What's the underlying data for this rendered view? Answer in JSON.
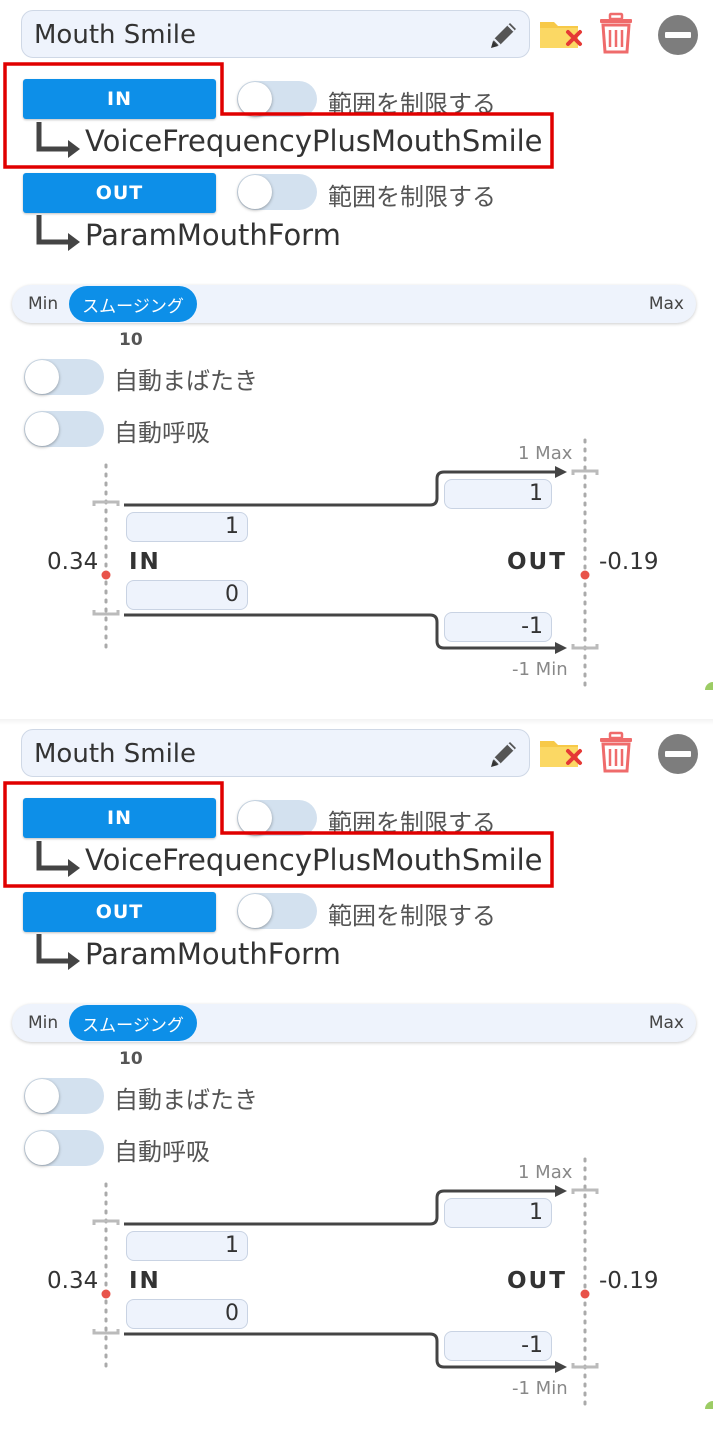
{
  "cards": [
    {
      "name": "Mouth Smile",
      "input": {
        "button_label": "IN",
        "limit_label": "範囲を制限する",
        "parameter": "VoiceFrequencyPlusMouthSmile"
      },
      "output": {
        "button_label": "OUT",
        "limit_label": "範囲を制限する",
        "parameter": "ParamMouthForm"
      },
      "smoothing": {
        "min_label": "Min",
        "max_label": "Max",
        "thumb_label": "スムージング",
        "value": "10"
      },
      "auto_blink_label": "自動まばたき",
      "auto_breath_label": "自動呼吸",
      "curve": {
        "in_label": "IN",
        "out_label": "OUT",
        "in_value": "0.34",
        "out_value": "-0.19",
        "in_max": "1",
        "in_min": "0",
        "out_max": "1",
        "out_min": "-1",
        "out_max_caption": "1 Max",
        "out_min_caption": "-1 Min"
      }
    },
    {
      "name": "Mouth Smile",
      "input": {
        "button_label": "IN",
        "limit_label": "範囲を制限する",
        "parameter": "VoiceFrequencyPlusMouthSmile"
      },
      "output": {
        "button_label": "OUT",
        "limit_label": "範囲を制限する",
        "parameter": "ParamMouthForm"
      },
      "smoothing": {
        "min_label": "Min",
        "max_label": "Max",
        "thumb_label": "スムージング",
        "value": "10"
      },
      "auto_blink_label": "自動まばたき",
      "auto_breath_label": "自動呼吸",
      "curve": {
        "in_label": "IN",
        "out_label": "OUT",
        "in_value": "0.34",
        "out_value": "-0.19",
        "in_max": "1",
        "in_min": "0",
        "out_max": "1",
        "out_min": "-1",
        "out_max_caption": "1 Max",
        "out_min_caption": "-1 Min"
      }
    }
  ],
  "colors": {
    "accent": "#0d8fe8",
    "highlight": "#e00000",
    "field_bg": "#eef3fc",
    "toggle_off": "#d3e1ef",
    "marker": "#e8534a"
  }
}
